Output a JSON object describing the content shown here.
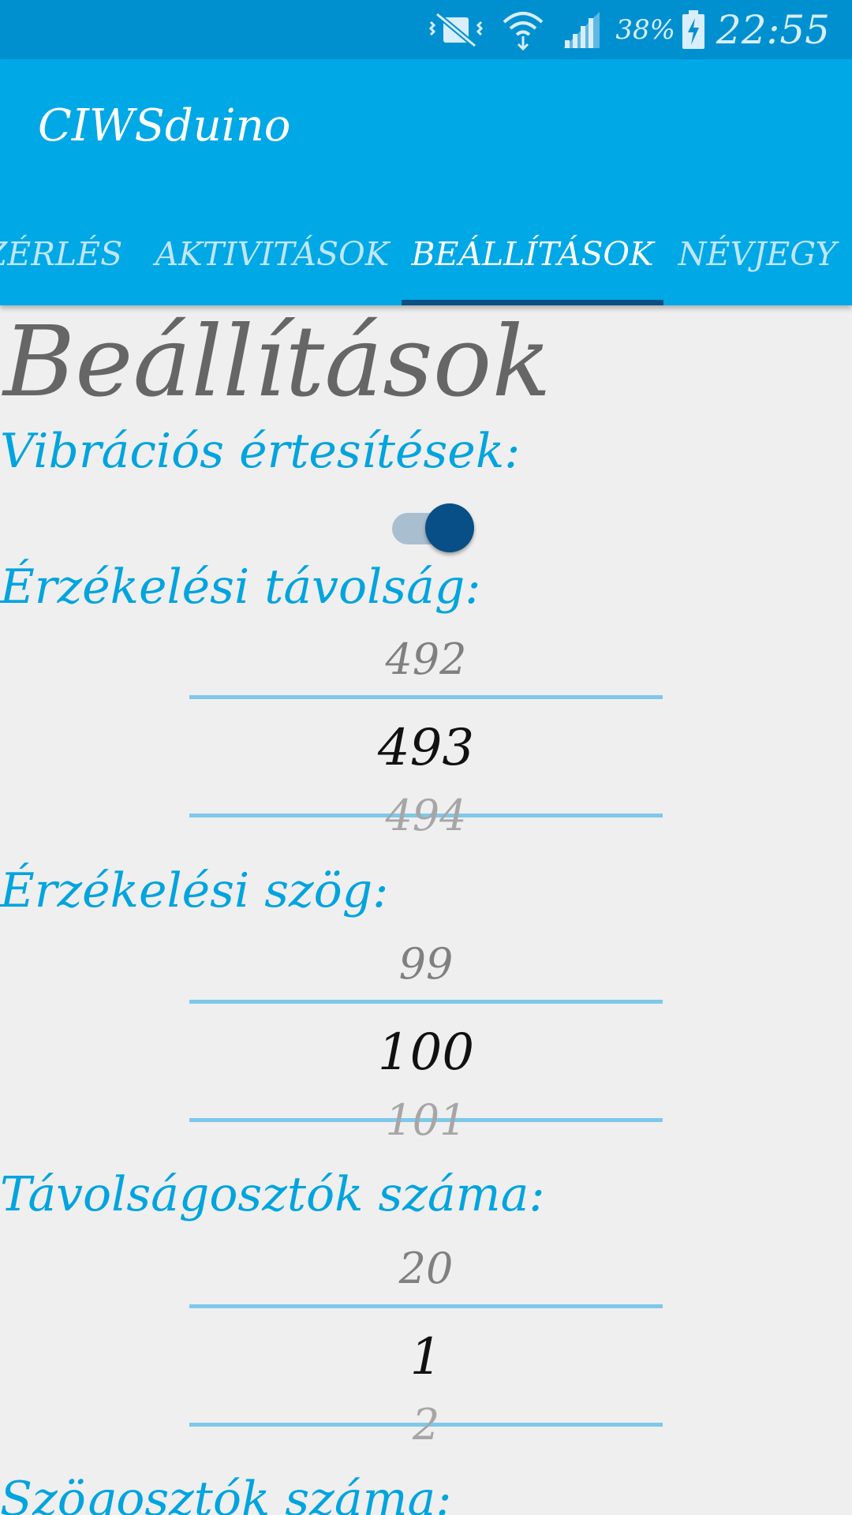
{
  "status_bar": {
    "icons": [
      "vibrate-mute-icon",
      "wifi-icon",
      "signal-icon",
      "battery-charging-icon"
    ],
    "battery": "38%",
    "time": "22:55"
  },
  "app_bar": {
    "title": "CIWSduino",
    "tabs": [
      {
        "label": "ZÉRLÉS",
        "active": false
      },
      {
        "label": "AKTIVITÁSOK",
        "active": false
      },
      {
        "label": "BEÁLLÍTÁSOK",
        "active": true
      },
      {
        "label": "NÉVJEGY",
        "active": false
      }
    ]
  },
  "main": {
    "title": "Beállítások",
    "vibration": {
      "label": "Vibrációs értesítések:",
      "enabled": true
    },
    "distance": {
      "label": "Érzékelési távolság:",
      "prev": "492",
      "value": "493",
      "next": "494"
    },
    "angle": {
      "label": "Érzékelési szög:",
      "prev": "99",
      "value": "100",
      "next": "101"
    },
    "distance_dividers": {
      "label": "Távolságosztók száma:",
      "prev": "20",
      "value": "1",
      "next": "2"
    },
    "angle_dividers": {
      "label": "Szögosztók száma:"
    }
  },
  "colors": {
    "status_bar": "#0090d0",
    "app_bar": "#00a8e6",
    "tab_indicator": "#0a4f84",
    "section_label": "#00a4de",
    "switch_thumb": "#074f86"
  }
}
